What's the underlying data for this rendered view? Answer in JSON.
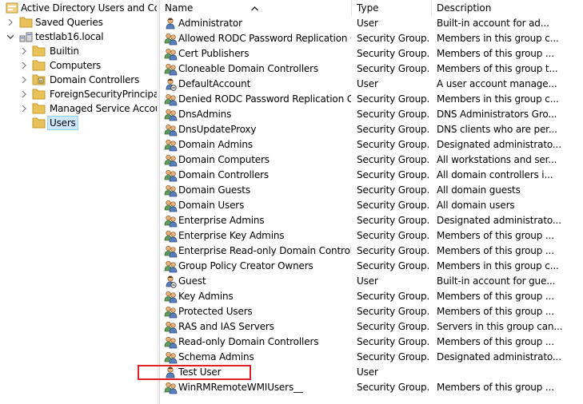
{
  "tree": {
    "root_label": "Active Directory Users and Com",
    "saved_queries_label": "Saved Queries",
    "domain_label": "testlab16.local",
    "children": [
      {
        "label": "Builtin",
        "icon": "folder-icon"
      },
      {
        "label": "Computers",
        "icon": "folder-icon"
      },
      {
        "label": "Domain Controllers",
        "icon": "ou-folder-icon"
      },
      {
        "label": "ForeignSecurityPrincipals",
        "icon": "folder-icon"
      },
      {
        "label": "Managed Service Accour",
        "icon": "folder-icon"
      },
      {
        "label": "Users",
        "icon": "folder-icon",
        "selected": true
      }
    ]
  },
  "columns": {
    "name": "Name",
    "type": "Type",
    "description": "Description"
  },
  "rows": [
    {
      "name": "Administrator",
      "type": "User",
      "description": "Built-in account for ad...",
      "icon": "user"
    },
    {
      "name": "Allowed RODC Password Replication G...",
      "type": "Security Group...",
      "description": "Members in this group c...",
      "icon": "group"
    },
    {
      "name": "Cert Publishers",
      "type": "Security Group...",
      "description": "Members of this group ...",
      "icon": "group"
    },
    {
      "name": "Cloneable Domain Controllers",
      "type": "Security Group...",
      "description": "Members of this group t...",
      "icon": "group"
    },
    {
      "name": "DefaultAccount",
      "type": "User",
      "description": "A user account manage...",
      "icon": "user-disabled"
    },
    {
      "name": "Denied RODC Password Replication Gr...",
      "type": "Security Group...",
      "description": "Members in this group c...",
      "icon": "group"
    },
    {
      "name": "DnsAdmins",
      "type": "Security Group...",
      "description": "DNS Administrators Gro...",
      "icon": "group"
    },
    {
      "name": "DnsUpdateProxy",
      "type": "Security Group...",
      "description": "DNS clients who are per...",
      "icon": "group"
    },
    {
      "name": "Domain Admins",
      "type": "Security Group...",
      "description": "Designated administrato...",
      "icon": "group"
    },
    {
      "name": "Domain Computers",
      "type": "Security Group...",
      "description": "All workstations and ser...",
      "icon": "group"
    },
    {
      "name": "Domain Controllers",
      "type": "Security Group...",
      "description": "All domain controllers i...",
      "icon": "group"
    },
    {
      "name": "Domain Guests",
      "type": "Security Group...",
      "description": "All domain guests",
      "icon": "group"
    },
    {
      "name": "Domain Users",
      "type": "Security Group...",
      "description": "All domain users",
      "icon": "group"
    },
    {
      "name": "Enterprise Admins",
      "type": "Security Group...",
      "description": "Designated administrato...",
      "icon": "group"
    },
    {
      "name": "Enterprise Key Admins",
      "type": "Security Group...",
      "description": "Members of this group ...",
      "icon": "group"
    },
    {
      "name": "Enterprise Read-only Domain Controllers",
      "type": "Security Group...",
      "description": "Members of this group ...",
      "icon": "group"
    },
    {
      "name": "Group Policy Creator Owners",
      "type": "Security Group...",
      "description": "Members in this group c...",
      "icon": "group"
    },
    {
      "name": "Guest",
      "type": "User",
      "description": "Built-in account for gue...",
      "icon": "user-disabled"
    },
    {
      "name": "Key Admins",
      "type": "Security Group...",
      "description": "Members of this group ...",
      "icon": "group"
    },
    {
      "name": "Protected Users",
      "type": "Security Group...",
      "description": "Members of this group ...",
      "icon": "group"
    },
    {
      "name": "RAS and IAS Servers",
      "type": "Security Group...",
      "description": "Servers in this group can...",
      "icon": "group"
    },
    {
      "name": "Read-only Domain Controllers",
      "type": "Security Group...",
      "description": "Members of this group ...",
      "icon": "group"
    },
    {
      "name": "Schema Admins",
      "type": "Security Group...",
      "description": "Designated administrato...",
      "icon": "group"
    },
    {
      "name": "Test User",
      "type": "User",
      "description": "",
      "icon": "user",
      "highlighted": true
    },
    {
      "name": "WinRMRemoteWMIUsers__",
      "type": "Security Group...",
      "description": "Members of this group ...",
      "icon": "group"
    }
  ],
  "colors": {
    "selection": "#cce8ff",
    "highlight_box": "#e0202a",
    "folder": "#e8c15a"
  }
}
